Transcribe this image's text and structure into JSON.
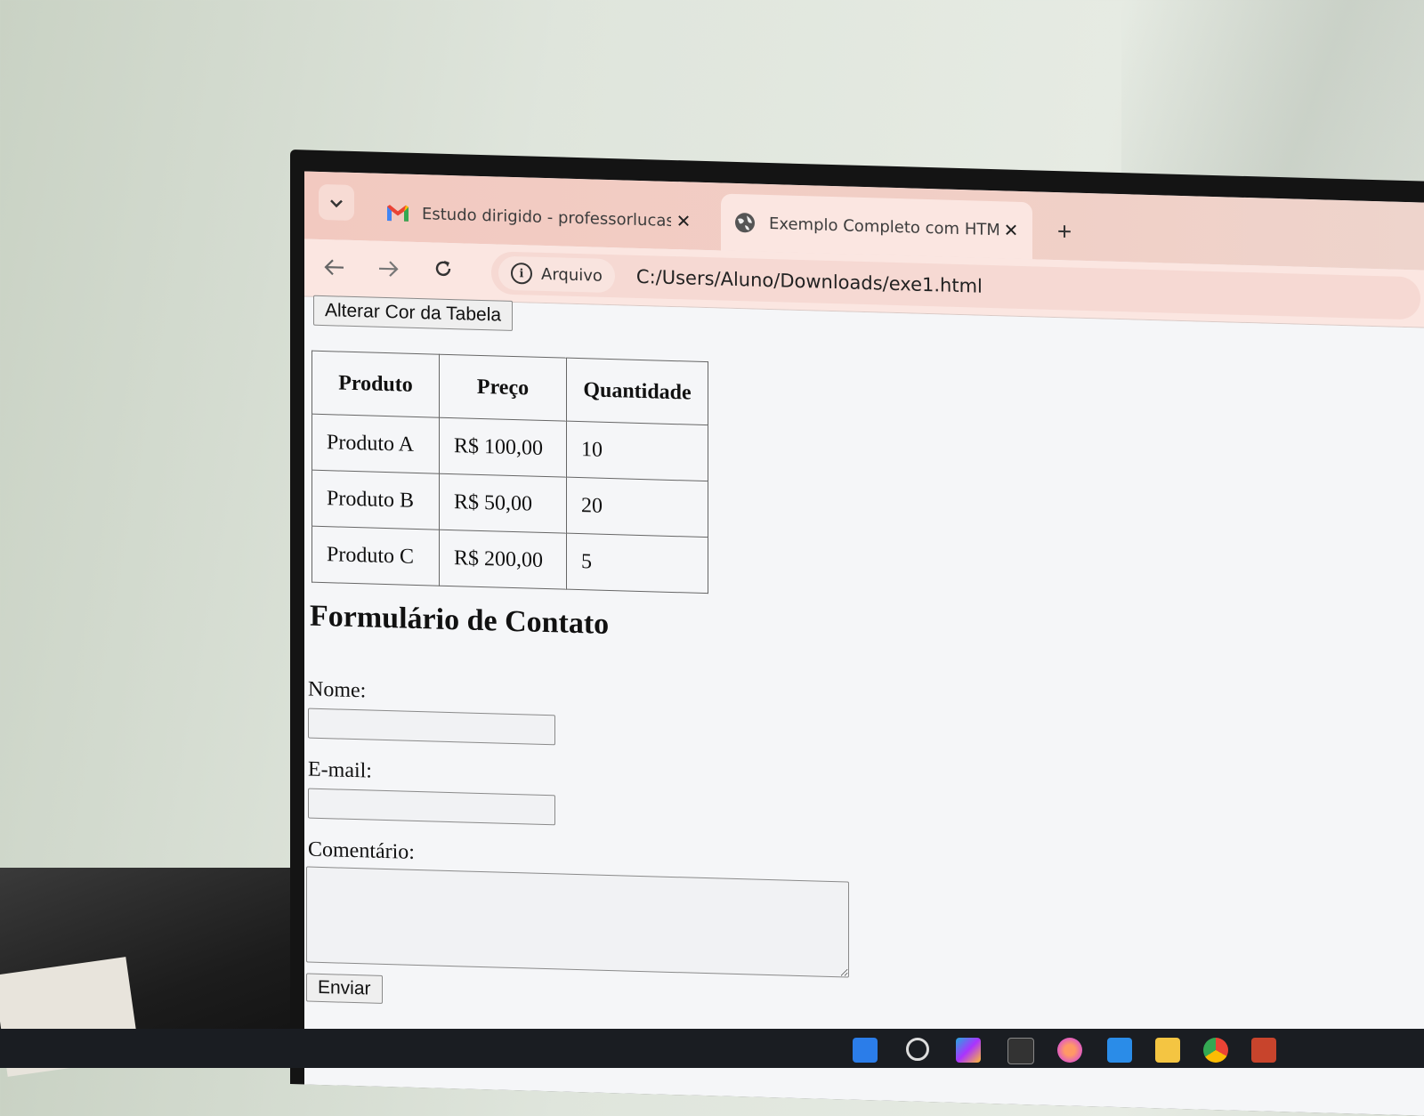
{
  "browser": {
    "tab_list_icon": "chevron-down-icon",
    "tabs": [
      {
        "title": "Estudo dirigido - professorlucas.sc",
        "icon": "gmail-icon",
        "active": false
      },
      {
        "title": "Exemplo Completo com HTML e Ja",
        "icon": "globe-icon",
        "active": true
      }
    ],
    "close_glyph": "✕",
    "new_tab_glyph": "+",
    "omnibox": {
      "site_label": "Arquivo",
      "url": "C:/Users/Aluno/Downloads/exe1.html"
    }
  },
  "page": {
    "change_color_button": "Alterar Cor da Tabela",
    "table": {
      "headers": [
        "Produto",
        "Preço",
        "Quantidade"
      ],
      "rows": [
        [
          "Produto A",
          "R$ 100,00",
          "10"
        ],
        [
          "Produto B",
          "R$ 50,00",
          "20"
        ],
        [
          "Produto C",
          "R$ 200,00",
          "5"
        ]
      ]
    },
    "form": {
      "title": "Formulário de Contato",
      "name_label": "Nome:",
      "email_label": "E-mail:",
      "comment_label": "Comentário:",
      "submit_label": "Enviar"
    }
  },
  "colors": {
    "tab_strip": "#f2c9c0",
    "toolbar": "#fbe6e1",
    "page_background": "#f5f6f8"
  }
}
